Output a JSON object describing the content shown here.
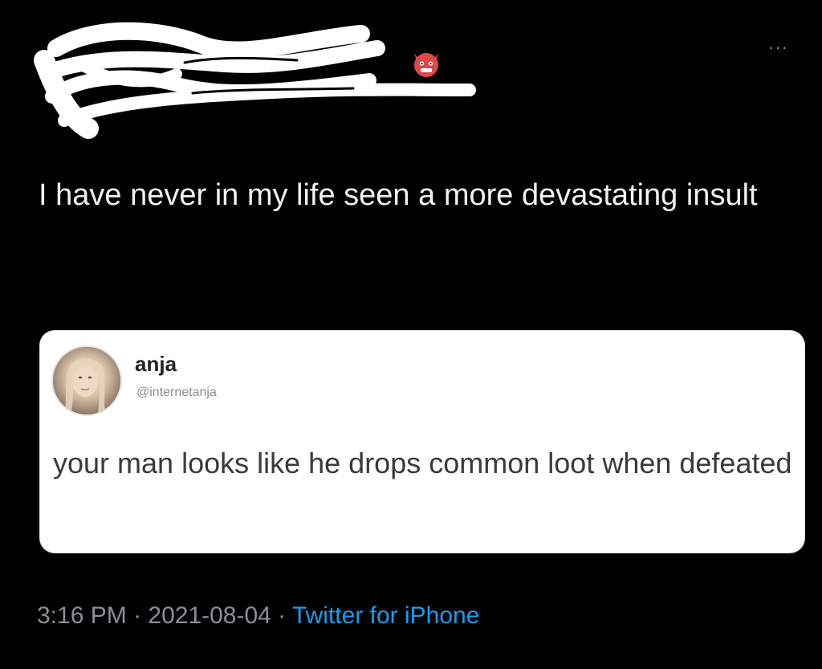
{
  "tweet": {
    "text": "I have never in my life seen a more devastating insult",
    "timestamp": "3:16 PM · 2021-08-04 · ",
    "source": "Twitter for iPhone",
    "more_icon": "more-horizontal-icon",
    "badge_icon": "devil-emoji-icon"
  },
  "quote": {
    "name": "anja",
    "handle": "@internetanja",
    "text": "your man looks like he drops common loot when defeated"
  },
  "colors": {
    "background": "#000000",
    "card": "#ffffff",
    "link": "#1d9bf0",
    "muted": "#8b8f94"
  }
}
